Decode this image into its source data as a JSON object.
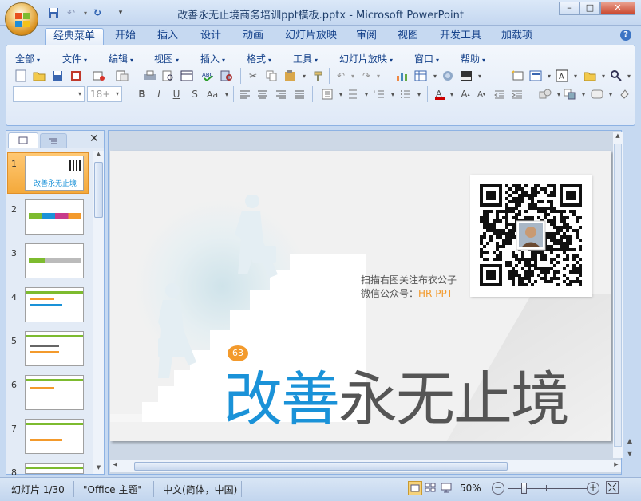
{
  "window": {
    "title": "改善永无止境商务培训ppt模板.pptx - Microsoft PowerPoint",
    "min": "–",
    "max": "□",
    "close": "✕"
  },
  "tabs": [
    {
      "label": "经典菜单",
      "active": true
    },
    {
      "label": "开始"
    },
    {
      "label": "插入"
    },
    {
      "label": "设计"
    },
    {
      "label": "动画"
    },
    {
      "label": "幻灯片放映"
    },
    {
      "label": "审阅"
    },
    {
      "label": "视图"
    },
    {
      "label": "开发工具"
    },
    {
      "label": "加载项"
    }
  ],
  "menus": [
    "全部",
    "文件",
    "编辑",
    "视图",
    "插入",
    "格式",
    "工具",
    "幻灯片放映",
    "窗口",
    "帮助"
  ],
  "format": {
    "font_size": "18+",
    "bold": "B",
    "italic": "I",
    "underline": "U",
    "shadow": "S",
    "font_aa": "Aa"
  },
  "thumbs": [
    {
      "num": "1"
    },
    {
      "num": "2"
    },
    {
      "num": "3"
    },
    {
      "num": "4"
    },
    {
      "num": "5"
    },
    {
      "num": "6"
    },
    {
      "num": "7"
    },
    {
      "num": "8"
    }
  ],
  "thumb1_title": "改善永无止境",
  "slide": {
    "title_blue": "改善",
    "title_gray": "永无止境",
    "badge": "63",
    "promo_line1": "扫描右图关注布衣公子",
    "promo_line2_label": "微信公众号：",
    "promo_line2_value": "HR-PPT"
  },
  "status": {
    "slide": "幻灯片 1/30",
    "theme": "\"Office 主题\"",
    "lang": "中文(简体，中国)",
    "zoom": "50%"
  },
  "colors": {
    "accent_blue": "#1a92d8",
    "accent_orange": "#f39a2c",
    "ribbon": "#dfe9f7"
  }
}
